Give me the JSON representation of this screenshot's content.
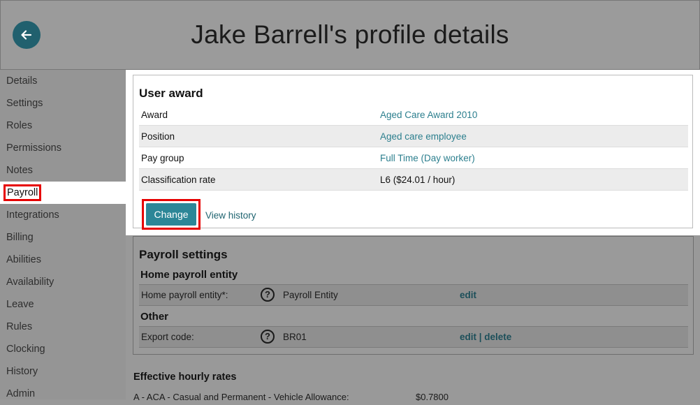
{
  "header": {
    "title": "Jake Barrell's profile details",
    "back_icon": "arrow-left-icon"
  },
  "sidebar": {
    "items": [
      {
        "label": "Details"
      },
      {
        "label": "Settings"
      },
      {
        "label": "Roles"
      },
      {
        "label": "Permissions"
      },
      {
        "label": "Notes"
      },
      {
        "label": "Payroll",
        "active": true
      },
      {
        "label": "Integrations"
      },
      {
        "label": "Billing"
      },
      {
        "label": "Abilities"
      },
      {
        "label": "Availability"
      },
      {
        "label": "Leave"
      },
      {
        "label": "Rules"
      },
      {
        "label": "Clocking"
      },
      {
        "label": "History"
      },
      {
        "label": "Admin"
      }
    ]
  },
  "user_award": {
    "title": "User award",
    "rows": [
      {
        "label": "Award",
        "value": "Aged Care Award 2010",
        "link": true
      },
      {
        "label": "Position",
        "value": "Aged care employee",
        "link": true
      },
      {
        "label": "Pay group",
        "value": "Full Time (Day worker)",
        "link": true
      },
      {
        "label": "Classification rate",
        "value": "L6 ($24.01 / hour)",
        "link": false
      }
    ],
    "change_label": "Change",
    "view_history_label": "View history"
  },
  "payroll_settings": {
    "title": "Payroll settings",
    "home_section": "Home payroll entity",
    "home_label": "Home payroll entity*:",
    "home_value": "Payroll Entity",
    "home_edit": "edit",
    "other_section": "Other",
    "export_label": "Export code:",
    "export_value": "BR01",
    "export_edit": "edit",
    "export_sep": " | ",
    "export_delete": "delete",
    "help_glyph": "?"
  },
  "rates": {
    "title": "Effective hourly rates",
    "rows": [
      {
        "label": "A - ACA - Casual and Permanent - Vehicle Allowance:",
        "value": "$0.7800"
      }
    ]
  },
  "colors": {
    "accent": "#2c8697",
    "link": "#2c7f8e",
    "highlight": "#e60000",
    "back_button": "#21606e"
  }
}
